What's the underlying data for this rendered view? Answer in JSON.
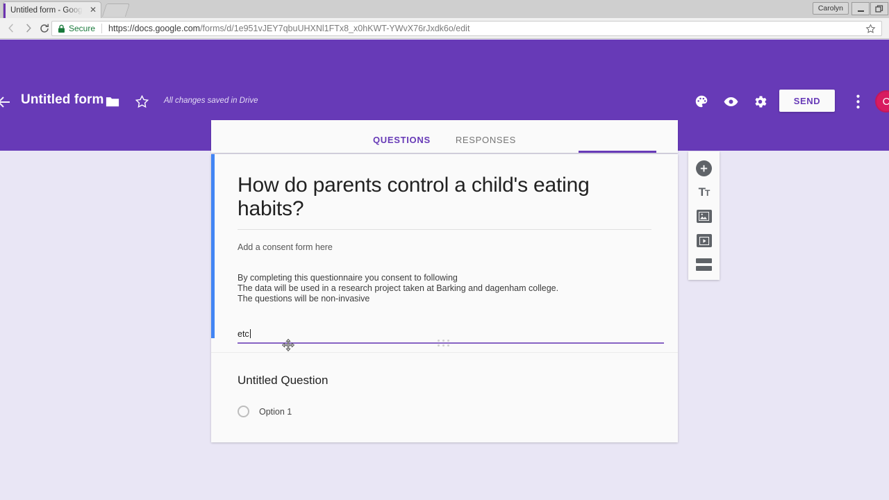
{
  "browser": {
    "tab_title": "Untitled form - Google F",
    "tab_close_glyph": "✕",
    "profile_label": "Carolyn",
    "secure_label": "Secure",
    "url_scheme": "https://",
    "url_host": "docs.google.com",
    "url_path": "/forms/d/1e951vJEY7qbuUHXNl1FTx8_x0hKWT-YWvX76rJxdk6o/edit",
    "url_full": "https://docs.google.com/forms/d/1e951vJEY7qbuUHXNl1FTx8_x0hKWT-YWvX76rJxdk6o/edit"
  },
  "app_header": {
    "title": "Untitled form",
    "save_status": "All changes saved in Drive",
    "send_label": "SEND",
    "avatar_initial": "C",
    "accent_color": "#673ab7",
    "avatar_color": "#d81b60"
  },
  "tabs": [
    {
      "label": "QUESTIONS",
      "active": true
    },
    {
      "label": "RESPONSES",
      "active": false
    }
  ],
  "form": {
    "title": "How do parents control a child's eating habits?",
    "subtitle": "Add a consent form here",
    "description_lines": [
      "By completing this questionnaire you consent to following",
      "The data will be used in a research project taken at Barking and dagenham college.",
      "The questions will be non-invasive"
    ],
    "editing_field_value": "etc",
    "active_accent_color": "#4285f4",
    "field_underline_color": "#8763c4"
  },
  "question": {
    "title": "Untitled Question",
    "options": [
      {
        "label": "Option 1"
      }
    ]
  },
  "side_toolbar": [
    {
      "icon": "add-question-icon"
    },
    {
      "icon": "add-title-icon"
    },
    {
      "icon": "add-image-icon"
    },
    {
      "icon": "add-video-icon"
    },
    {
      "icon": "add-section-icon"
    }
  ]
}
